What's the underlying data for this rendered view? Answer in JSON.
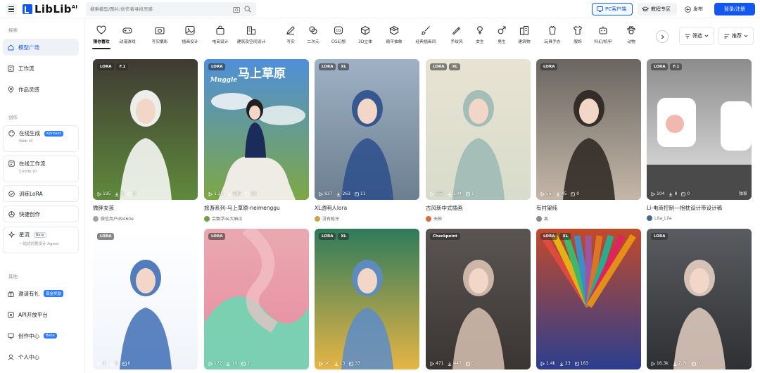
{
  "header": {
    "logo_text": "LibLib",
    "logo_sup": "AI",
    "search_placeholder": "搜索模型/图片/创作者寻找灵感",
    "pc_client": "PC客户端",
    "tutorial": "教程专区",
    "publish": "发布",
    "login": "登录/注册"
  },
  "sidebar": {
    "explore_label": "探索",
    "explore_items": [
      {
        "label": "模型广场",
        "icon": "home-icon"
      },
      {
        "label": "工作流",
        "icon": "workflow-icon"
      },
      {
        "label": "作品灵感",
        "icon": "location-icon"
      }
    ],
    "create_label": "创作",
    "online_gen": {
      "label": "在线生成",
      "badge": "Kontext",
      "sub": "Web UI"
    },
    "online_workflow": {
      "label": "在线工作流",
      "sub": "Comfy UI"
    },
    "train_lora": "训练LoRA",
    "quick_create": "快捷创作",
    "star_stream": {
      "label": "星流",
      "badge": "Beta",
      "sub": "一站式创意设计 Agent"
    },
    "other_label": "其他",
    "invite": {
      "label": "邀请有礼",
      "badge": "现金奖励"
    },
    "api": "API开放平台",
    "creator_center": {
      "label": "创作中心",
      "badge": "Beta"
    },
    "personal": "个人中心"
  },
  "categories": [
    {
      "label": "猜你喜欢",
      "icon": "heart-icon"
    },
    {
      "label": "动漫游戏",
      "icon": "gamepad-icon"
    },
    {
      "label": "写实摄影",
      "icon": "camera-icon"
    },
    {
      "label": "插画设计",
      "icon": "image-icon"
    },
    {
      "label": "电商设计",
      "icon": "shopping-bag-icon"
    },
    {
      "label": "建筑及空间设计",
      "icon": "building-icon"
    },
    {
      "label": "写实",
      "icon": "pen-icon"
    },
    {
      "label": "二次元",
      "icon": "palette-icon"
    },
    {
      "label": "CG幻想",
      "icon": "cg-icon"
    },
    {
      "label": "3D立体",
      "icon": "cube-icon"
    },
    {
      "label": "扁平抽象",
      "icon": "box-icon"
    },
    {
      "label": "经典插画风",
      "icon": "brush-icon"
    },
    {
      "label": "手绘风",
      "icon": "pencil-icon"
    },
    {
      "label": "女生",
      "icon": "female-icon"
    },
    {
      "label": "男生",
      "icon": "male-icon"
    },
    {
      "label": "建筑物",
      "icon": "city-icon"
    },
    {
      "label": "玩具手办",
      "icon": "toy-icon"
    },
    {
      "label": "服饰",
      "icon": "shirt-icon"
    },
    {
      "label": "科幻/机甲",
      "icon": "robot-icon"
    },
    {
      "label": "动物",
      "icon": "paw-icon"
    }
  ],
  "filter_label": "筛选",
  "sort_label": "推荐",
  "cards": [
    {
      "badges": [
        "LORA",
        "F.1"
      ],
      "stats": [
        "195",
        "0",
        "0"
      ],
      "title": "微胖女孩",
      "author": "微信用户d9460e",
      "exclusive": "",
      "colors": {
        "top": "#3f3a33",
        "bottom": "#5f8a3c",
        "accent": "#ffffff"
      }
    },
    {
      "badges": [
        "LORA"
      ],
      "stats": [
        "1.3k",
        "685",
        "28"
      ],
      "title": "旅游系列-马上草原-neimenggu",
      "author": "会飘浮de大麻瓜",
      "exclusive": "",
      "overlay_title": "马上草原",
      "overlay_sub": "Muggle",
      "colors": {
        "top": "#4f8fd9",
        "bottom": "#7da845",
        "accent": "#1b2c5a"
      }
    },
    {
      "badges": [
        "LORA",
        "XL"
      ],
      "stats": [
        "837",
        "263",
        "11"
      ],
      "title": "XL透明人lora",
      "author": "没有鲑牙",
      "exclusive": "",
      "colors": {
        "top": "#9fb2c5",
        "bottom": "#6c7f90",
        "accent": "#2c4f8c"
      }
    },
    {
      "badges": [
        "LORA",
        "XL"
      ],
      "stats": [
        "563",
        "104",
        "1"
      ],
      "title": "古风新中式插画",
      "author": "天邮",
      "exclusive": "",
      "colors": {
        "top": "#e8e3d3",
        "bottom": "#d8dccb",
        "accent": "#9cb9b4"
      }
    },
    {
      "badges": [
        "LORA"
      ],
      "stats": [
        "56",
        "45",
        "0"
      ],
      "title": "有村架纯",
      "author": "离",
      "exclusive": "",
      "colors": {
        "top": "#6a6560",
        "bottom": "#c4b7a8",
        "accent": "#2a2420"
      }
    },
    {
      "badges": [
        "LORA",
        "F.1"
      ],
      "stats": [
        "104",
        "8",
        "0"
      ],
      "title": "Li-电商控制---抱枕设计带设计稿",
      "author": "Lita_Lila",
      "exclusive": "独家",
      "colors": {
        "top": "#8c8c8c",
        "bottom": "#e6e6e6",
        "accent": "#ffffff"
      }
    },
    {
      "badges": [
        "LORA"
      ],
      "stats": [
        "4",
        "5",
        "0"
      ],
      "title": "",
      "author": "",
      "exclusive": "",
      "colors": {
        "top": "#ffffff",
        "bottom": "#f0f4fa",
        "accent": "#3e6fb5"
      }
    },
    {
      "badges": [
        "LORA"
      ],
      "stats": [
        "172",
        "19",
        "2"
      ],
      "title": "",
      "author": "",
      "exclusive": "",
      "colors": {
        "top": "#e9a9b0",
        "bottom": "#e88aa0",
        "accent": "#6fd6b4"
      }
    },
    {
      "badges": [
        "LORA",
        "XL"
      ],
      "stats": [
        "90",
        "13",
        "33"
      ],
      "title": "",
      "author": "",
      "exclusive": "",
      "colors": {
        "top": "#2f7a5b",
        "bottom": "#e6b545",
        "accent": "#5c8cc9"
      }
    },
    {
      "badges": [
        "Checkpoint"
      ],
      "stats": [
        "471",
        "447",
        "0"
      ],
      "title": "",
      "author": "",
      "exclusive": "",
      "colors": {
        "top": "#5a5552",
        "bottom": "#3a3533",
        "accent": "#d8c2b2"
      }
    },
    {
      "badges": [
        "LORA",
        "XL"
      ],
      "stats": [
        "1.4k",
        "23",
        "163"
      ],
      "title": "",
      "author": "",
      "exclusive": "",
      "colors": {
        "top": "#c24a2a",
        "bottom": "#2b3e8f",
        "accent": "#e8c84c"
      }
    },
    {
      "badges": [
        "LORA"
      ],
      "stats": [
        "16.3k",
        "2.7k",
        "0"
      ],
      "title": "",
      "author": "",
      "exclusive": "",
      "colors": {
        "top": "#595c60",
        "bottom": "#2e3033",
        "accent": "#e4cfc2"
      }
    }
  ]
}
